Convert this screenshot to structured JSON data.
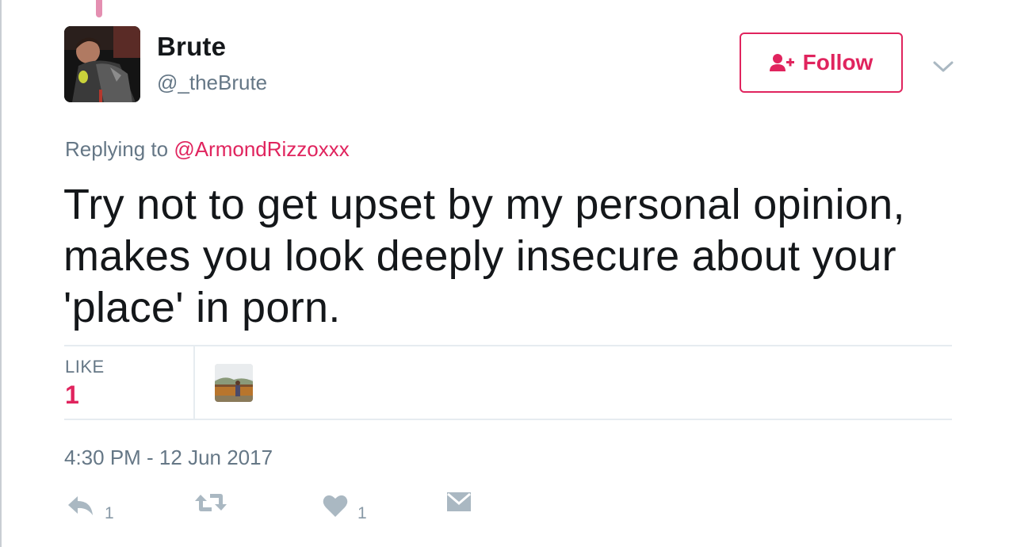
{
  "tweet": {
    "author": {
      "display_name": "Brute",
      "screen_name": "@_theBrute"
    },
    "follow_label": "Follow",
    "replying_prefix": "Replying to",
    "replying_to": "@ArmondRizzoxxx",
    "text": "Try not to get upset by my personal opinion, makes you look deeply insecure about your 'place' in porn.",
    "stats": {
      "like_label": "LIKE",
      "like_count": "1"
    },
    "timestamp": "4:30 PM - 12 Jun 2017",
    "actions": {
      "reply_count": "1",
      "like_count": "1"
    }
  },
  "colors": {
    "accent": "#e0245e",
    "muted": "#657786",
    "icon": "#aab8c2",
    "divider": "#e6ecf0"
  },
  "icons": {
    "follow": "person-plus-icon",
    "more": "chevron-down-icon",
    "reply": "reply-icon",
    "retweet": "retweet-icon",
    "like": "heart-icon",
    "dm": "envelope-icon"
  }
}
